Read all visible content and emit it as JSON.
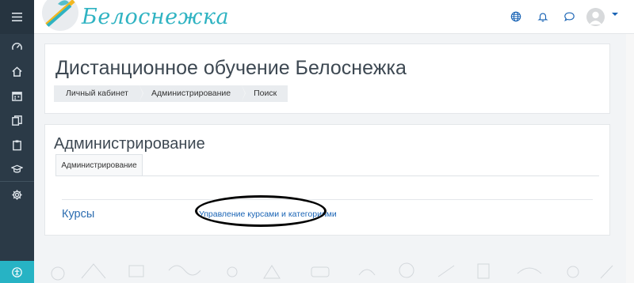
{
  "header": {
    "logo_text": "Белоснежка"
  },
  "sidebar": {
    "items": [
      {
        "icon": "hamburger-menu-icon"
      },
      {
        "icon": "dashboard-icon"
      },
      {
        "icon": "home-icon"
      },
      {
        "icon": "calendar-icon"
      },
      {
        "icon": "files-icon"
      },
      {
        "icon": "clipboard-icon"
      },
      {
        "icon": "graduation-cap-icon"
      },
      {
        "icon": "gear-icon"
      },
      {
        "icon": "accessibility-icon"
      }
    ]
  },
  "page": {
    "title": "Дистанционное обучение Белоснежка",
    "breadcrumb": [
      "Личный кабинет",
      "Администрирование",
      "Поиск"
    ]
  },
  "admin": {
    "title": "Администрирование",
    "tab_label": "Администрирование",
    "row_label": "Курсы",
    "row_link": "Управление курсами и категориями"
  },
  "colors": {
    "sidebar": "#2b3a47",
    "accent": "#27b3c4",
    "link": "#1a64b5"
  }
}
